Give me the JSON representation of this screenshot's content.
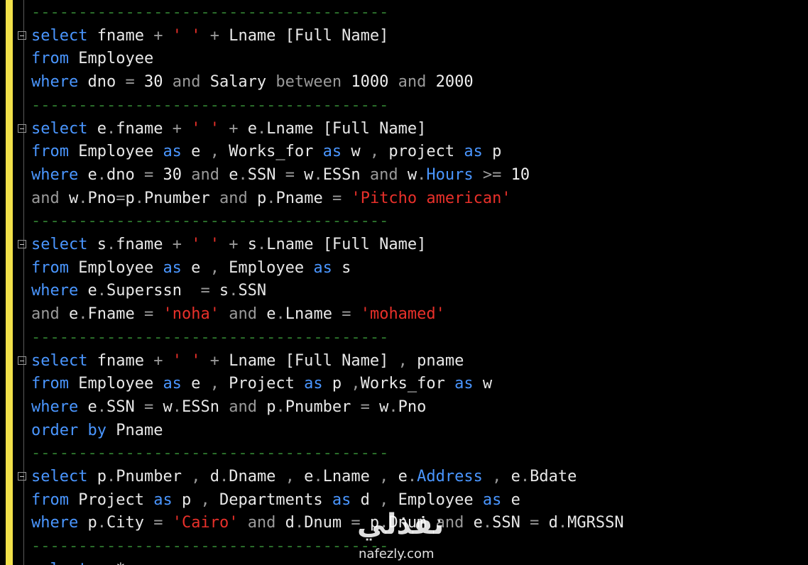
{
  "editor": {
    "lines": [
      {
        "fold": false,
        "tokens": [
          {
            "c": "sep",
            "t": "--------------------------------------"
          }
        ]
      },
      {
        "fold": true,
        "tokens": [
          {
            "c": "kw",
            "t": "select"
          },
          {
            "c": "fn",
            "t": " fname "
          },
          {
            "c": "op",
            "t": "+"
          },
          {
            "c": "fn",
            "t": " "
          },
          {
            "c": "str",
            "t": "' '"
          },
          {
            "c": "fn",
            "t": " "
          },
          {
            "c": "op",
            "t": "+"
          },
          {
            "c": "fn",
            "t": " Lname [Full Name]"
          }
        ]
      },
      {
        "fold": false,
        "tokens": [
          {
            "c": "kw",
            "t": "from"
          },
          {
            "c": "fn",
            "t": " Employee"
          }
        ]
      },
      {
        "fold": false,
        "tokens": [
          {
            "c": "kw",
            "t": "where"
          },
          {
            "c": "fn",
            "t": " dno "
          },
          {
            "c": "op",
            "t": "="
          },
          {
            "c": "num",
            "t": " 30 "
          },
          {
            "c": "op",
            "t": "and"
          },
          {
            "c": "fn",
            "t": " Salary "
          },
          {
            "c": "op",
            "t": "between"
          },
          {
            "c": "num",
            "t": " 1000 "
          },
          {
            "c": "op",
            "t": "and"
          },
          {
            "c": "num",
            "t": " 2000"
          }
        ]
      },
      {
        "fold": false,
        "tokens": [
          {
            "c": "sep",
            "t": "--------------------------------------"
          }
        ]
      },
      {
        "fold": true,
        "tokens": [
          {
            "c": "kw",
            "t": "select"
          },
          {
            "c": "fn",
            "t": " e"
          },
          {
            "c": "op",
            "t": "."
          },
          {
            "c": "fn",
            "t": "fname "
          },
          {
            "c": "op",
            "t": "+"
          },
          {
            "c": "fn",
            "t": " "
          },
          {
            "c": "str",
            "t": "' '"
          },
          {
            "c": "fn",
            "t": " "
          },
          {
            "c": "op",
            "t": "+"
          },
          {
            "c": "fn",
            "t": " e"
          },
          {
            "c": "op",
            "t": "."
          },
          {
            "c": "fn",
            "t": "Lname [Full Name]"
          }
        ]
      },
      {
        "fold": false,
        "tokens": [
          {
            "c": "kw",
            "t": "from"
          },
          {
            "c": "fn",
            "t": " Employee "
          },
          {
            "c": "kw",
            "t": "as"
          },
          {
            "c": "fn",
            "t": " e "
          },
          {
            "c": "op",
            "t": ","
          },
          {
            "c": "fn",
            "t": " Works_for "
          },
          {
            "c": "kw",
            "t": "as"
          },
          {
            "c": "fn",
            "t": " w "
          },
          {
            "c": "op",
            "t": ","
          },
          {
            "c": "fn",
            "t": " project "
          },
          {
            "c": "kw",
            "t": "as"
          },
          {
            "c": "fn",
            "t": " p"
          }
        ]
      },
      {
        "fold": false,
        "tokens": [
          {
            "c": "kw",
            "t": "where"
          },
          {
            "c": "fn",
            "t": " e"
          },
          {
            "c": "op",
            "t": "."
          },
          {
            "c": "fn",
            "t": "dno "
          },
          {
            "c": "op",
            "t": "="
          },
          {
            "c": "num",
            "t": " 30 "
          },
          {
            "c": "op",
            "t": "and"
          },
          {
            "c": "fn",
            "t": " e"
          },
          {
            "c": "op",
            "t": "."
          },
          {
            "c": "fn",
            "t": "SSN "
          },
          {
            "c": "op",
            "t": "="
          },
          {
            "c": "fn",
            "t": " w"
          },
          {
            "c": "op",
            "t": "."
          },
          {
            "c": "fn",
            "t": "ESSn "
          },
          {
            "c": "op",
            "t": "and"
          },
          {
            "c": "fn",
            "t": " w"
          },
          {
            "c": "op",
            "t": "."
          },
          {
            "c": "kw",
            "t": "Hours"
          },
          {
            "c": "fn",
            "t": " "
          },
          {
            "c": "op",
            "t": ">="
          },
          {
            "c": "num",
            "t": " 10"
          }
        ]
      },
      {
        "fold": false,
        "tokens": [
          {
            "c": "op",
            "t": "and"
          },
          {
            "c": "fn",
            "t": " w"
          },
          {
            "c": "op",
            "t": "."
          },
          {
            "c": "fn",
            "t": "Pno"
          },
          {
            "c": "op",
            "t": "="
          },
          {
            "c": "fn",
            "t": "p"
          },
          {
            "c": "op",
            "t": "."
          },
          {
            "c": "fn",
            "t": "Pnumber "
          },
          {
            "c": "op",
            "t": "and"
          },
          {
            "c": "fn",
            "t": " p"
          },
          {
            "c": "op",
            "t": "."
          },
          {
            "c": "fn",
            "t": "Pname "
          },
          {
            "c": "op",
            "t": "="
          },
          {
            "c": "fn",
            "t": " "
          },
          {
            "c": "str",
            "t": "'Pitcho american'"
          }
        ]
      },
      {
        "fold": false,
        "tokens": [
          {
            "c": "sep",
            "t": "--------------------------------------"
          }
        ]
      },
      {
        "fold": true,
        "tokens": [
          {
            "c": "kw",
            "t": "select"
          },
          {
            "c": "fn",
            "t": " s"
          },
          {
            "c": "op",
            "t": "."
          },
          {
            "c": "fn",
            "t": "fname "
          },
          {
            "c": "op",
            "t": "+"
          },
          {
            "c": "fn",
            "t": " "
          },
          {
            "c": "str",
            "t": "' '"
          },
          {
            "c": "fn",
            "t": " "
          },
          {
            "c": "op",
            "t": "+"
          },
          {
            "c": "fn",
            "t": " s"
          },
          {
            "c": "op",
            "t": "."
          },
          {
            "c": "fn",
            "t": "Lname [Full Name]"
          }
        ]
      },
      {
        "fold": false,
        "tokens": [
          {
            "c": "kw",
            "t": "from"
          },
          {
            "c": "fn",
            "t": " Employee "
          },
          {
            "c": "kw",
            "t": "as"
          },
          {
            "c": "fn",
            "t": " e "
          },
          {
            "c": "op",
            "t": ","
          },
          {
            "c": "fn",
            "t": " Employee "
          },
          {
            "c": "kw",
            "t": "as"
          },
          {
            "c": "fn",
            "t": " s"
          }
        ]
      },
      {
        "fold": false,
        "tokens": [
          {
            "c": "kw",
            "t": "where"
          },
          {
            "c": "fn",
            "t": " e"
          },
          {
            "c": "op",
            "t": "."
          },
          {
            "c": "fn",
            "t": "Superssn  "
          },
          {
            "c": "op",
            "t": "="
          },
          {
            "c": "fn",
            "t": " s"
          },
          {
            "c": "op",
            "t": "."
          },
          {
            "c": "fn",
            "t": "SSN"
          }
        ]
      },
      {
        "fold": false,
        "tokens": [
          {
            "c": "op",
            "t": "and"
          },
          {
            "c": "fn",
            "t": " e"
          },
          {
            "c": "op",
            "t": "."
          },
          {
            "c": "fn",
            "t": "Fname "
          },
          {
            "c": "op",
            "t": "="
          },
          {
            "c": "fn",
            "t": " "
          },
          {
            "c": "str",
            "t": "'noha'"
          },
          {
            "c": "fn",
            "t": " "
          },
          {
            "c": "op",
            "t": "and"
          },
          {
            "c": "fn",
            "t": " e"
          },
          {
            "c": "op",
            "t": "."
          },
          {
            "c": "fn",
            "t": "Lname "
          },
          {
            "c": "op",
            "t": "="
          },
          {
            "c": "fn",
            "t": " "
          },
          {
            "c": "str",
            "t": "'mohamed'"
          }
        ]
      },
      {
        "fold": false,
        "tokens": [
          {
            "c": "sep",
            "t": "--------------------------------------"
          }
        ]
      },
      {
        "fold": true,
        "tokens": [
          {
            "c": "kw",
            "t": "select"
          },
          {
            "c": "fn",
            "t": " fname "
          },
          {
            "c": "op",
            "t": "+"
          },
          {
            "c": "fn",
            "t": " "
          },
          {
            "c": "str",
            "t": "' '"
          },
          {
            "c": "fn",
            "t": " "
          },
          {
            "c": "op",
            "t": "+"
          },
          {
            "c": "fn",
            "t": " Lname [Full Name] "
          },
          {
            "c": "op",
            "t": ","
          },
          {
            "c": "fn",
            "t": " pname"
          }
        ]
      },
      {
        "fold": false,
        "tokens": [
          {
            "c": "kw",
            "t": "from"
          },
          {
            "c": "fn",
            "t": " Employee "
          },
          {
            "c": "kw",
            "t": "as"
          },
          {
            "c": "fn",
            "t": " e "
          },
          {
            "c": "op",
            "t": ","
          },
          {
            "c": "fn",
            "t": " Project "
          },
          {
            "c": "kw",
            "t": "as"
          },
          {
            "c": "fn",
            "t": " p "
          },
          {
            "c": "op",
            "t": ","
          },
          {
            "c": "fn",
            "t": "Works_for "
          },
          {
            "c": "kw",
            "t": "as"
          },
          {
            "c": "fn",
            "t": " w"
          }
        ]
      },
      {
        "fold": false,
        "tokens": [
          {
            "c": "kw",
            "t": "where"
          },
          {
            "c": "fn",
            "t": " e"
          },
          {
            "c": "op",
            "t": "."
          },
          {
            "c": "fn",
            "t": "SSN "
          },
          {
            "c": "op",
            "t": "="
          },
          {
            "c": "fn",
            "t": " w"
          },
          {
            "c": "op",
            "t": "."
          },
          {
            "c": "fn",
            "t": "ESSn "
          },
          {
            "c": "op",
            "t": "and"
          },
          {
            "c": "fn",
            "t": " p"
          },
          {
            "c": "op",
            "t": "."
          },
          {
            "c": "fn",
            "t": "Pnumber "
          },
          {
            "c": "op",
            "t": "="
          },
          {
            "c": "fn",
            "t": " w"
          },
          {
            "c": "op",
            "t": "."
          },
          {
            "c": "fn",
            "t": "Pno"
          }
        ]
      },
      {
        "fold": false,
        "tokens": [
          {
            "c": "kw",
            "t": "order"
          },
          {
            "c": "fn",
            "t": " "
          },
          {
            "c": "kw",
            "t": "by"
          },
          {
            "c": "fn",
            "t": " Pname"
          }
        ]
      },
      {
        "fold": false,
        "tokens": [
          {
            "c": "sep",
            "t": "--------------------------------------"
          }
        ]
      },
      {
        "fold": true,
        "tokens": [
          {
            "c": "kw",
            "t": "select"
          },
          {
            "c": "fn",
            "t": " p"
          },
          {
            "c": "op",
            "t": "."
          },
          {
            "c": "fn",
            "t": "Pnumber "
          },
          {
            "c": "op",
            "t": ","
          },
          {
            "c": "fn",
            "t": " d"
          },
          {
            "c": "op",
            "t": "."
          },
          {
            "c": "fn",
            "t": "Dname "
          },
          {
            "c": "op",
            "t": ","
          },
          {
            "c": "fn",
            "t": " e"
          },
          {
            "c": "op",
            "t": "."
          },
          {
            "c": "fn",
            "t": "Lname "
          },
          {
            "c": "op",
            "t": ","
          },
          {
            "c": "fn",
            "t": " e"
          },
          {
            "c": "op",
            "t": "."
          },
          {
            "c": "kw",
            "t": "Address"
          },
          {
            "c": "fn",
            "t": " "
          },
          {
            "c": "op",
            "t": ","
          },
          {
            "c": "fn",
            "t": " e"
          },
          {
            "c": "op",
            "t": "."
          },
          {
            "c": "fn",
            "t": "Bdate"
          }
        ]
      },
      {
        "fold": false,
        "tokens": [
          {
            "c": "kw",
            "t": "from"
          },
          {
            "c": "fn",
            "t": " Project "
          },
          {
            "c": "kw",
            "t": "as"
          },
          {
            "c": "fn",
            "t": " p "
          },
          {
            "c": "op",
            "t": ","
          },
          {
            "c": "fn",
            "t": " Departments "
          },
          {
            "c": "kw",
            "t": "as"
          },
          {
            "c": "fn",
            "t": " d "
          },
          {
            "c": "op",
            "t": ","
          },
          {
            "c": "fn",
            "t": " Employee "
          },
          {
            "c": "kw",
            "t": "as"
          },
          {
            "c": "fn",
            "t": " e"
          }
        ]
      },
      {
        "fold": false,
        "tokens": [
          {
            "c": "kw",
            "t": "where"
          },
          {
            "c": "fn",
            "t": " p"
          },
          {
            "c": "op",
            "t": "."
          },
          {
            "c": "fn",
            "t": "City "
          },
          {
            "c": "op",
            "t": "="
          },
          {
            "c": "fn",
            "t": " "
          },
          {
            "c": "str",
            "t": "'Cairo'"
          },
          {
            "c": "fn",
            "t": " "
          },
          {
            "c": "op",
            "t": "and"
          },
          {
            "c": "fn",
            "t": " d"
          },
          {
            "c": "op",
            "t": "."
          },
          {
            "c": "fn",
            "t": "Dnum "
          },
          {
            "c": "op",
            "t": "="
          },
          {
            "c": "fn",
            "t": " p"
          },
          {
            "c": "op",
            "t": "."
          },
          {
            "c": "fn",
            "t": "Dnum "
          },
          {
            "c": "op",
            "t": "and"
          },
          {
            "c": "fn",
            "t": " e"
          },
          {
            "c": "op",
            "t": "."
          },
          {
            "c": "fn",
            "t": "SSN "
          },
          {
            "c": "op",
            "t": "="
          },
          {
            "c": "fn",
            "t": " d"
          },
          {
            "c": "op",
            "t": "."
          },
          {
            "c": "fn",
            "t": "MGRSSN"
          }
        ]
      },
      {
        "fold": false,
        "tokens": [
          {
            "c": "sep",
            "t": "--------------------------------------"
          }
        ]
      },
      {
        "fold": true,
        "tokens": [
          {
            "c": "kw",
            "t": "select"
          },
          {
            "c": "fn",
            "t": " e"
          },
          {
            "c": "op",
            "t": "."
          },
          {
            "c": "fn",
            "t": "*"
          }
        ]
      }
    ]
  },
  "colors": {
    "background": "#000000",
    "keyword": "#4a96ff",
    "string": "#e8302a",
    "operator": "#9a9a9a",
    "comment_separator": "#2f7a2f",
    "change_marker": "#f2e14a"
  },
  "watermark": {
    "arabic_text": "نفذلي",
    "latin_text": "nafezly.com"
  }
}
